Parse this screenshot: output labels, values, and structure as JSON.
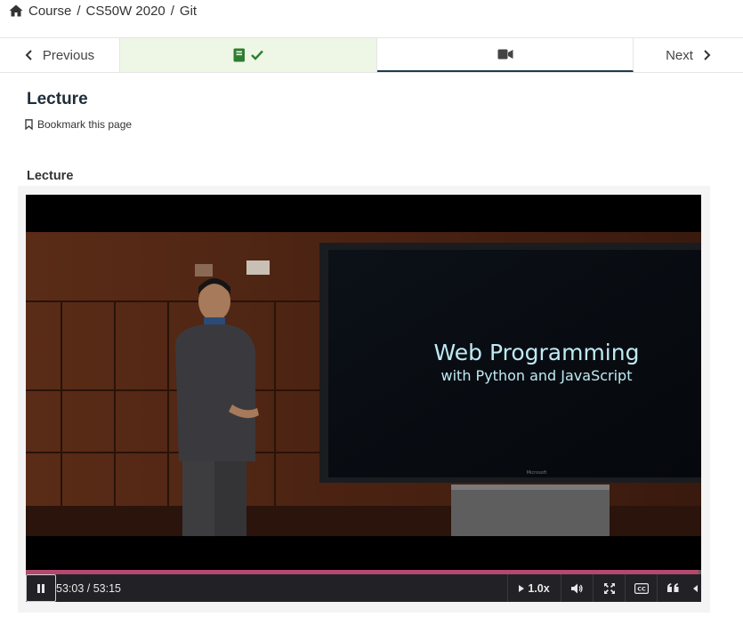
{
  "breadcrumb": {
    "items": [
      "Course",
      "CS50W 2020",
      "Git"
    ],
    "separator": "/"
  },
  "sequence_nav": {
    "previous_label": "Previous",
    "next_label": "Next",
    "units": [
      {
        "icon": "book-icon",
        "status": "completed",
        "status_icon": "check-icon"
      },
      {
        "icon": "video-icon",
        "status": "active"
      }
    ]
  },
  "unit": {
    "title": "Lecture",
    "bookmark_label": "Bookmark this page"
  },
  "section": {
    "title": "Lecture"
  },
  "video": {
    "slide_title": "Web Programming",
    "slide_subtitle": "with Python and JavaScript",
    "screen_brand": "Microsoft",
    "current_time": "53:03",
    "duration": "53:15",
    "time_display": "53:03 / 53:15",
    "progress_fraction": 0.996,
    "speed": "1.0x"
  },
  "colors": {
    "completed_unit_bg": "#eef7e6",
    "completed_green": "#2e7d32",
    "progress": "#b3496e",
    "active_underline": "#1f3b4d"
  }
}
